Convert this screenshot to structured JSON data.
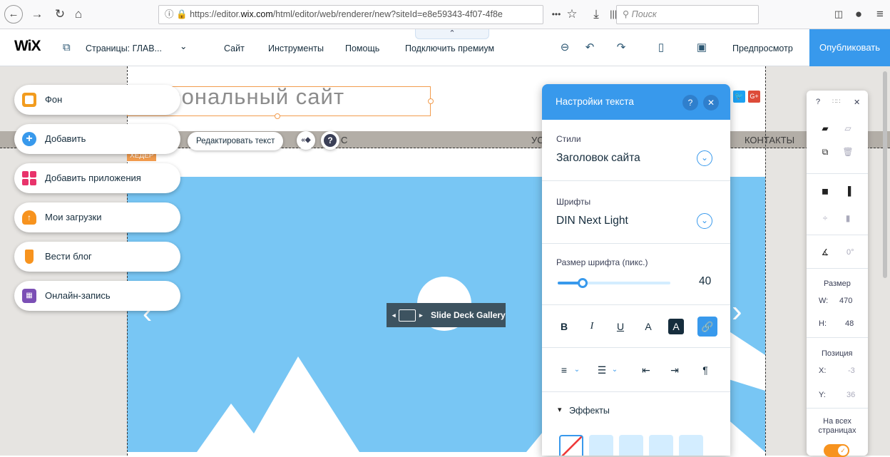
{
  "browser": {
    "url_prefix": "https://editor.",
    "url_domain": "wix.com",
    "url_rest": "/html/editor/web/renderer/new?siteId=e8e59343-4f07-4f8e",
    "more_label": "•••",
    "search_placeholder": "Поиск"
  },
  "toolbar": {
    "logo": "WiX",
    "pages_label": "Страницы: ГЛАВ...",
    "pages_chevron": "⌄",
    "menu": [
      "Сайт",
      "Инструменты",
      "Помощь",
      "Подключить премиум"
    ],
    "collapse_glyph": "⌃",
    "preview_label": "Предпросмотр",
    "publish_label": "Опубликовать"
  },
  "site": {
    "title": "Персональный сайт",
    "header_tag": "ХЕДЕР",
    "nav_items": [
      "С",
      "УС",
      "КОНТАКТЫ"
    ],
    "gallery_label": "Slide Deck Gallery",
    "social": {
      "twitter": "🐦",
      "gplus": "G+"
    }
  },
  "left_panel": {
    "items": [
      {
        "label": "Фон",
        "icon": "background-icon",
        "color": "#f29c1f"
      },
      {
        "label": "Добавить",
        "icon": "add-icon",
        "color": "#3899ec"
      },
      {
        "label": "Добавить приложения",
        "icon": "apps-icon",
        "color": "#e8336b"
      },
      {
        "label": "Мои загрузки",
        "icon": "upload-icon",
        "color": "#f7931e"
      },
      {
        "label": "Вести блог",
        "icon": "blog-icon",
        "color": "#f7931e"
      },
      {
        "label": "Онлайн-запись",
        "icon": "calendar-icon",
        "color": "#7b4fb5"
      }
    ]
  },
  "floating_toolbar": {
    "edit_text_label": "Редактировать текст",
    "help_glyph": "?",
    "animation_glyph": "«◆"
  },
  "text_settings": {
    "title": "Настройки текста",
    "help_glyph": "?",
    "close_glyph": "✕",
    "styles_label": "Стили",
    "styles_value": "Заголовок сайта",
    "fonts_label": "Шрифты",
    "fonts_value": "DIN Next Light",
    "size_label": "Размер шрифта (пикс.)",
    "size_value": "40",
    "size_fraction": 0.22,
    "format_buttons": [
      "B",
      "I",
      "U",
      "A",
      "A",
      "🔗"
    ],
    "align_glyph": "≡",
    "list_glyph": "☰",
    "dropdown_glyph": "⌄",
    "indent_glyphs": [
      "⇤",
      "⇥",
      "¶"
    ],
    "effects_label": "Эффекты",
    "effects_arrow": "▾"
  },
  "right_panel": {
    "help_glyph": "?",
    "drag_glyph": "∷∷",
    "close_glyph": "✕",
    "angle_value": "0°",
    "size_label": "Размер",
    "w_label": "W:",
    "w_value": "470",
    "h_label": "H:",
    "h_value": "48",
    "position_label": "Позиция",
    "x_label": "X:",
    "x_value": "-3",
    "y_label": "Y:",
    "y_value": "36",
    "all_pages_label": "На всех страницах",
    "all_pages_on": true
  },
  "colors": {
    "accent": "#3899ec",
    "selection": "#f29c4e",
    "hero_blue": "#78c6f4",
    "toggle": "#f7931e"
  }
}
